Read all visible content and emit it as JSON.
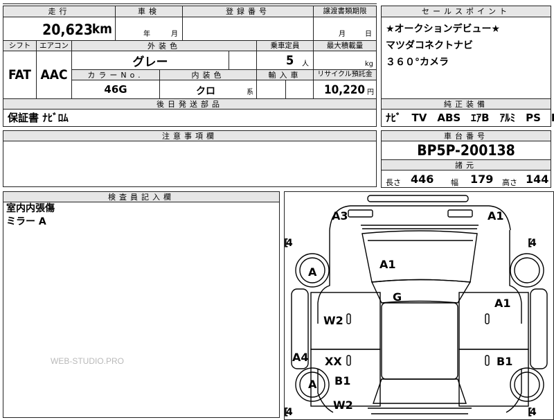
{
  "mileage": {
    "label": "走行",
    "value": "20,623",
    "unit": "km"
  },
  "inspection": {
    "label": "車検",
    "year_unit": "年",
    "month_unit": "月"
  },
  "registration": {
    "label": "登録番号"
  },
  "transfer_deadline": {
    "label": "譲渡書類期限",
    "month_unit": "月",
    "day_unit": "日"
  },
  "shift": {
    "label": "シフト",
    "value": "FAT"
  },
  "aircon": {
    "label": "エアコン",
    "value": "AAC"
  },
  "exterior_color": {
    "label": "外装色",
    "value": "グレー"
  },
  "capacity": {
    "label": "乗車定員",
    "value": "5",
    "unit": "人"
  },
  "max_load": {
    "label": "最大積載量",
    "unit": "kg"
  },
  "color_no": {
    "label": "カラーNo.",
    "value": "46G"
  },
  "interior_color": {
    "label": "内装色",
    "value": "クロ",
    "suffix": "系"
  },
  "import": {
    "label": "輸入車"
  },
  "recycle": {
    "label": "リサイクル預託金",
    "value": "10,220",
    "unit": "円"
  },
  "delivery": {
    "label": "後日発送部品",
    "value": "保証書 ﾅﾋﾞﾛﾑ"
  },
  "sales_points": {
    "label": "セールスポイント",
    "lines": [
      "★オークションデビュー★",
      "マツダコネクトナビ",
      "３６０°カメラ"
    ]
  },
  "equipment": {
    "label": "純正装備",
    "value": "ﾅﾋﾞ　TV　ABS　ｴｱB　ｱﾙﾐ　PS　PW"
  },
  "notes": {
    "label": "注意事項欄"
  },
  "chassis": {
    "label": "車台番号",
    "value": "BP5P-200138"
  },
  "specs": {
    "label": "諸元",
    "length_label": "長さ",
    "length": "446",
    "width_label": "幅",
    "width": "179",
    "height_label": "高さ",
    "height": "144"
  },
  "inspector": {
    "label": "検査員記入欄",
    "lines": [
      "室内内張傷",
      "ミラー A"
    ]
  },
  "diagram": {
    "marks": {
      "front_left_corner": "A3",
      "front_right_corner": "A1",
      "hood": "A1",
      "left_front_wheel": "A",
      "roof": "G",
      "right_front_door": "A1",
      "left_front_door": "W2",
      "left_rocker": "A4",
      "left_rear_door": "XX",
      "right_rear_door": "B1",
      "left_rear_wheel": "A",
      "left_rear_fender": "B1",
      "rear_left": "W2"
    },
    "tire_brackets": [
      "4",
      "4",
      "4",
      "4"
    ]
  },
  "watermark": "WEB-STUDIO.PRO"
}
